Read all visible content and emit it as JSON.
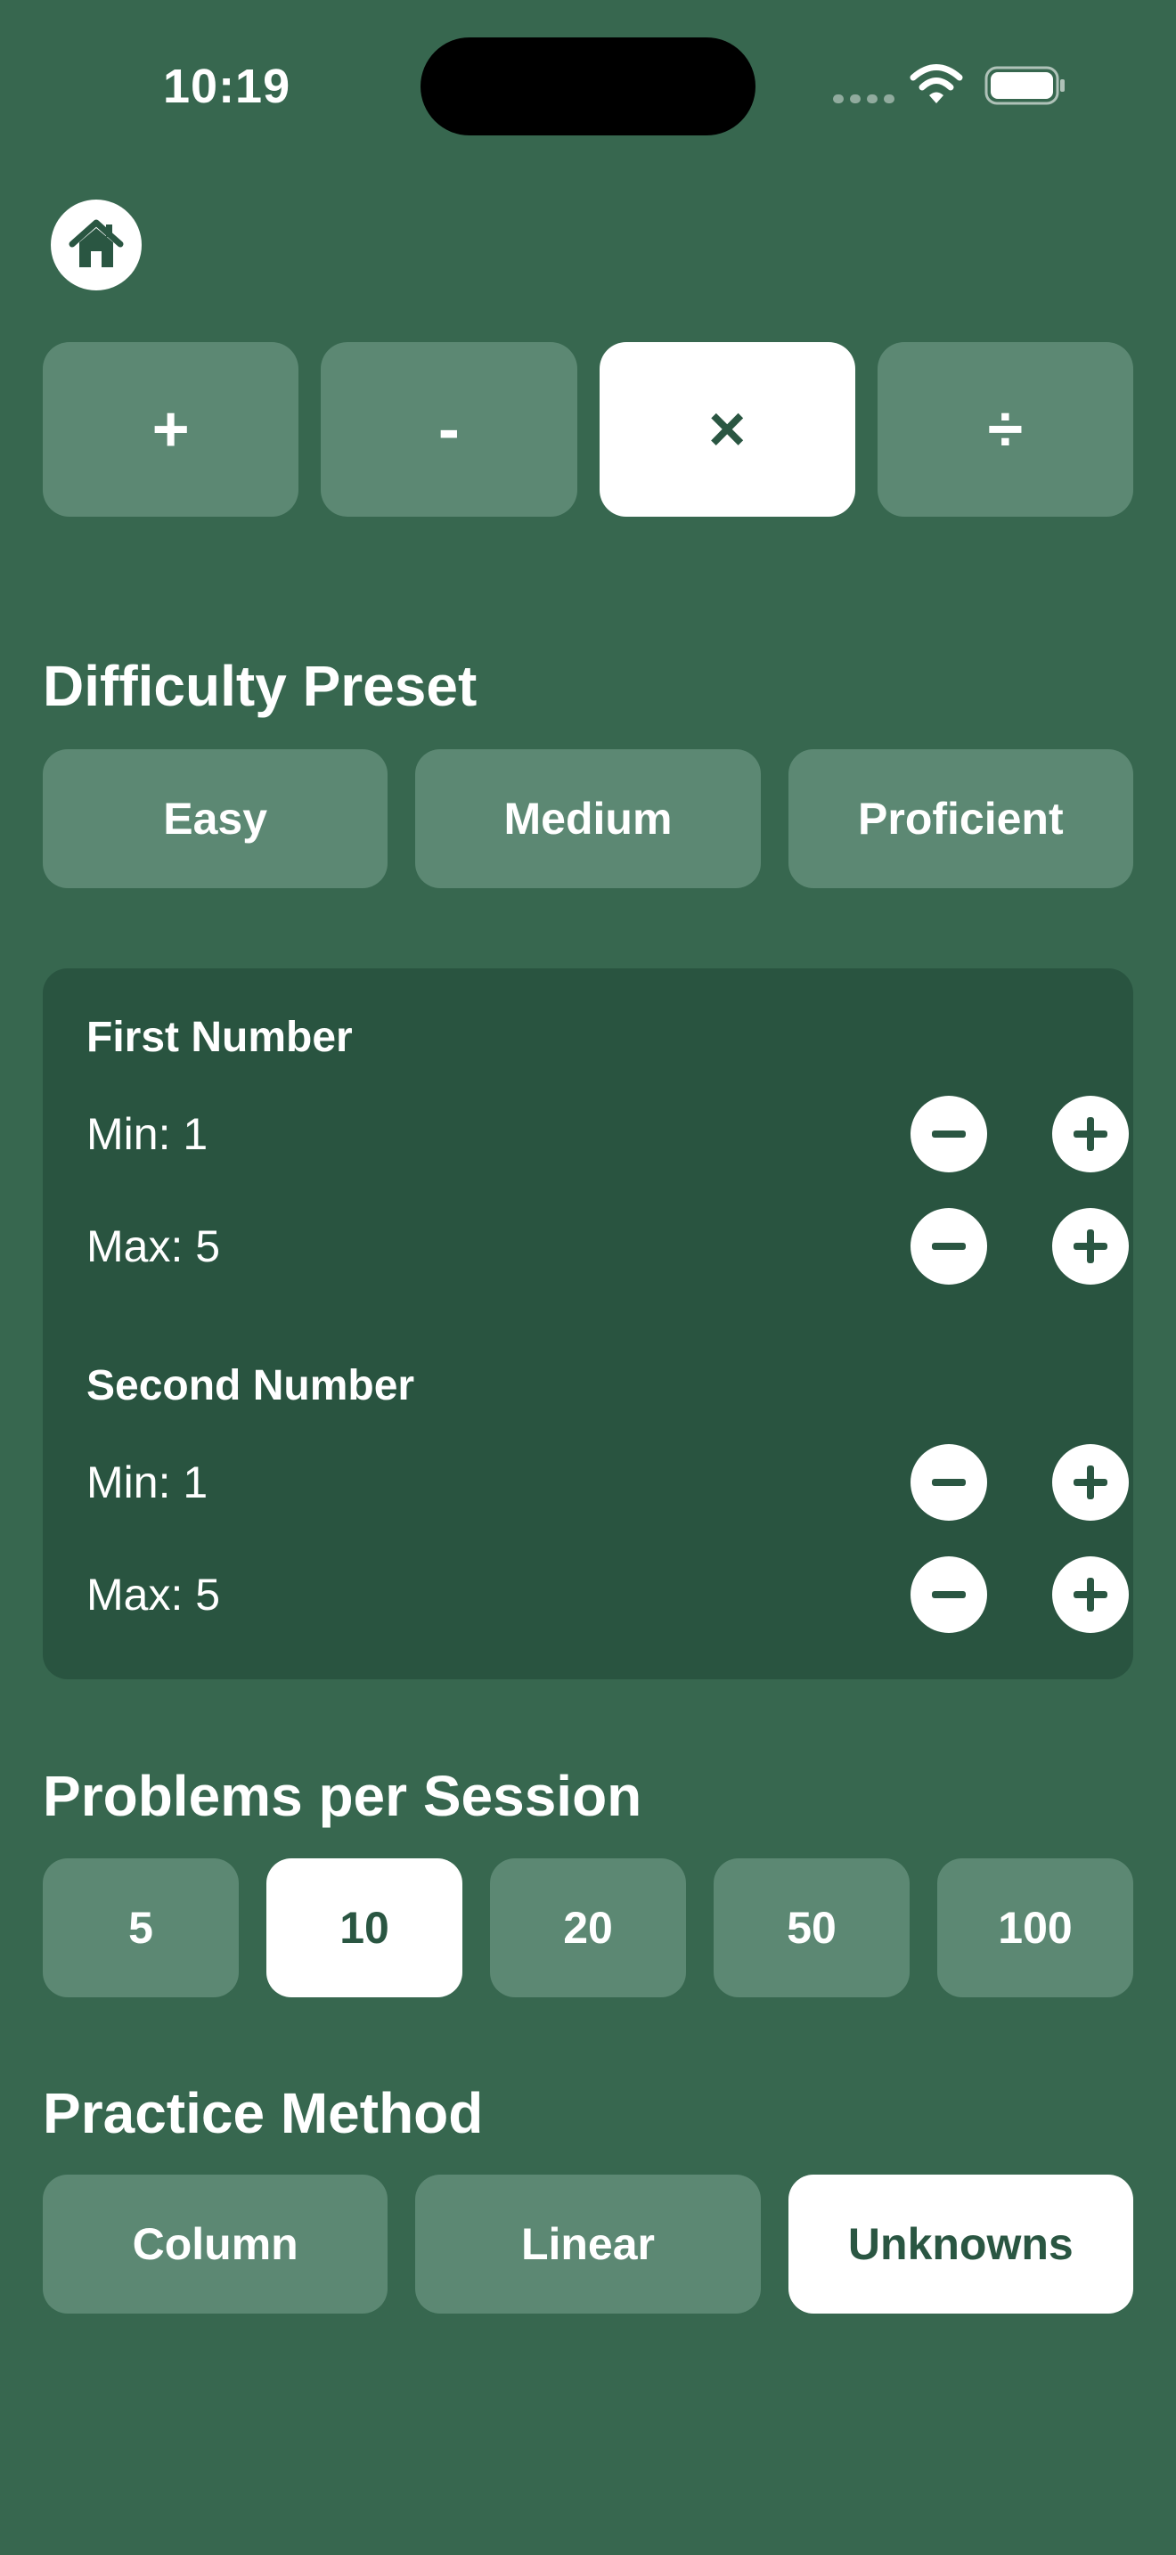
{
  "status_bar": {
    "time": "10:19",
    "icons": [
      "signal-icon",
      "wifi-icon",
      "battery-icon"
    ]
  },
  "home": {
    "icon": "home-icon"
  },
  "operations": [
    {
      "label": "+",
      "selected": false
    },
    {
      "label": "-",
      "selected": false
    },
    {
      "label": "×",
      "selected": true
    },
    {
      "label": "÷",
      "selected": false
    }
  ],
  "difficulty": {
    "title": "Difficulty Preset",
    "options": [
      "Easy",
      "Medium",
      "Proficient"
    ]
  },
  "ranges": {
    "first": {
      "title": "First Number",
      "min_label": "Min: 1",
      "max_label": "Max: 5"
    },
    "second": {
      "title": "Second Number",
      "min_label": "Min: 1",
      "max_label": "Max: 5"
    }
  },
  "problems": {
    "title": "Problems per Session",
    "options": [
      "5",
      "10",
      "20",
      "50",
      "100"
    ],
    "selected": "10"
  },
  "method": {
    "title": "Practice Method",
    "options": [
      "Column",
      "Linear",
      "Unknowns"
    ],
    "selected": "Unknowns"
  },
  "colors": {
    "background": "#37674f",
    "card": "#295440",
    "button": "#5c8873",
    "selected_text": "#2a5642"
  }
}
